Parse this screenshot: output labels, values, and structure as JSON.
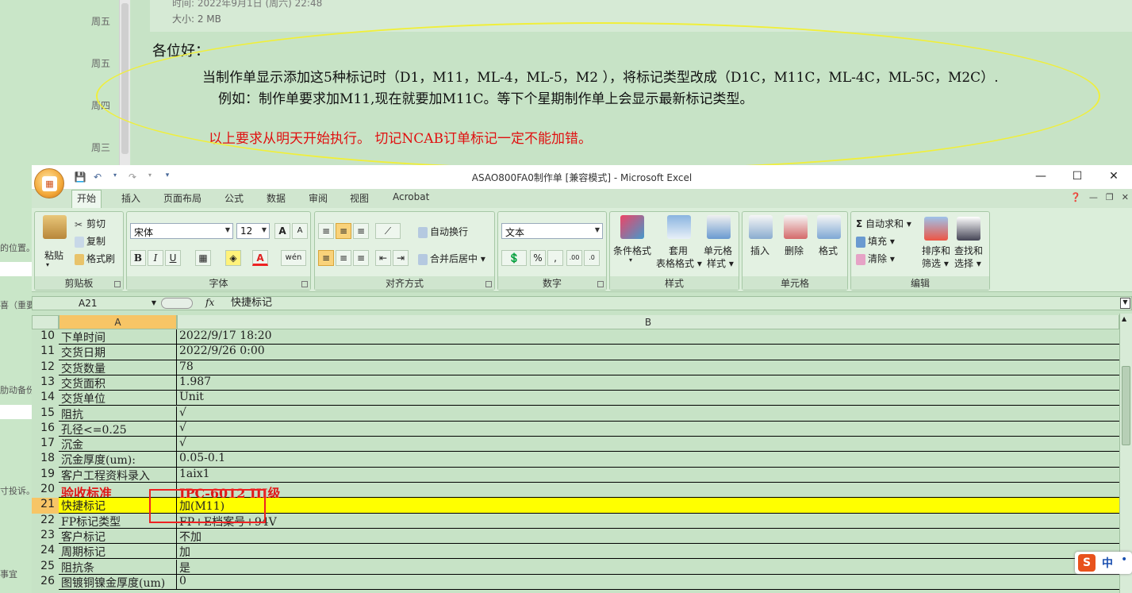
{
  "background": {
    "weekdays": [
      "周五",
      "周五",
      "周四",
      "周三"
    ],
    "left_fragments": [
      "的位置。",
      "喜（重要",
      "肋动备份",
      "寸投诉。",
      "事宜"
    ]
  },
  "email": {
    "meta_time": "时间: 2022年9月1日 (周六) 22:48",
    "meta_size": "大小: 2 MB",
    "greeting": "各位好：",
    "line1": "当制作单显示添加这5种标记时（D1，M11，ML-4，ML-5，M2 ），将标记类型改成（D1C，M11C，ML-4C，ML-5C，M2C）.",
    "line2": "例如：制作单要求加M11,现在就要加M11C。等下个星期制作单上会显示最新标记类型。",
    "line3": "以上要求从明天开始执行。 切记NCAB订单标记一定不能加错。"
  },
  "excel": {
    "window_title": "ASAO800FA0制作单  [兼容模式] - Microsoft Excel",
    "winctl": {
      "minimize": "—",
      "maximize": "☐",
      "close": "✕"
    },
    "tabs": [
      "开始",
      "插入",
      "页面布局",
      "公式",
      "数据",
      "审阅",
      "视图",
      "Acrobat"
    ],
    "ribbon": {
      "clipboard": {
        "label": "剪贴板",
        "paste": "粘贴",
        "cut": "剪切",
        "copy": "复制",
        "format_painter": "格式刷"
      },
      "font": {
        "label": "字体",
        "name": "宋体",
        "size": "12",
        "grow": "A",
        "shrink": "A",
        "bold": "B",
        "italic": "I",
        "underline": "U",
        "wen": "wén"
      },
      "alignment": {
        "label": "对齐方式",
        "wrap": "自动换行",
        "merge": "合并后居中"
      },
      "number": {
        "label": "数字",
        "format": "文本",
        "percent": "%",
        "comma": ","
      },
      "styles": {
        "label": "样式",
        "conditional": "条件格式",
        "table_fmt_1": "套用",
        "table_fmt_2": "表格格式",
        "cell_style_1": "单元格",
        "cell_style_2": "样式"
      },
      "cells": {
        "label": "单元格",
        "insert": "插入",
        "delete": "删除",
        "format": "格式"
      },
      "editing": {
        "label": "编辑",
        "autosum": "自动求和",
        "fill": "填充",
        "clear": "清除",
        "sort_1": "排序和",
        "sort_2": "筛选",
        "find_1": "查找和",
        "find_2": "选择"
      }
    },
    "name_box": "A21",
    "fx": "fx",
    "formula": "快捷标记",
    "columns": [
      "A",
      "B"
    ],
    "rows": [
      {
        "n": "10",
        "a": "下单时间",
        "b": "2022/9/17 18:20"
      },
      {
        "n": "11",
        "a": "交货日期",
        "b": "2022/9/26 0:00"
      },
      {
        "n": "12",
        "a": "交货数量",
        "b": "78"
      },
      {
        "n": "13",
        "a": "交货面积",
        "b": "1.987"
      },
      {
        "n": "14",
        "a": "交货单位",
        "b": "Unit"
      },
      {
        "n": "15",
        "a": "阻抗",
        "b": "√"
      },
      {
        "n": "16",
        "a": "孔径<=0.25",
        "b": "√"
      },
      {
        "n": "17",
        "a": "沉金",
        "b": "√"
      },
      {
        "n": "18",
        "a": "沉金厚度(um):",
        "b": "0.05-0.1"
      },
      {
        "n": "19",
        "a": "客户工程资料录入",
        "b": "1aix1"
      },
      {
        "n": "20",
        "a": "验收标准",
        "b": "IPC-6012 III级"
      },
      {
        "n": "21",
        "a": "快捷标记",
        "b": "加(M11)"
      },
      {
        "n": "22",
        "a": "FP标记类型",
        "b": "FP+E档案号+94V"
      },
      {
        "n": "23",
        "a": "客户标记",
        "b": "不加"
      },
      {
        "n": "24",
        "a": "周期标记",
        "b": "加"
      },
      {
        "n": "25",
        "a": "阻抗条",
        "b": "是"
      },
      {
        "n": "26",
        "a": "图镀铜镍金厚度(um)",
        "b": "0"
      }
    ]
  },
  "ime": {
    "logo": "S",
    "mode": "中",
    "dot": "•"
  }
}
